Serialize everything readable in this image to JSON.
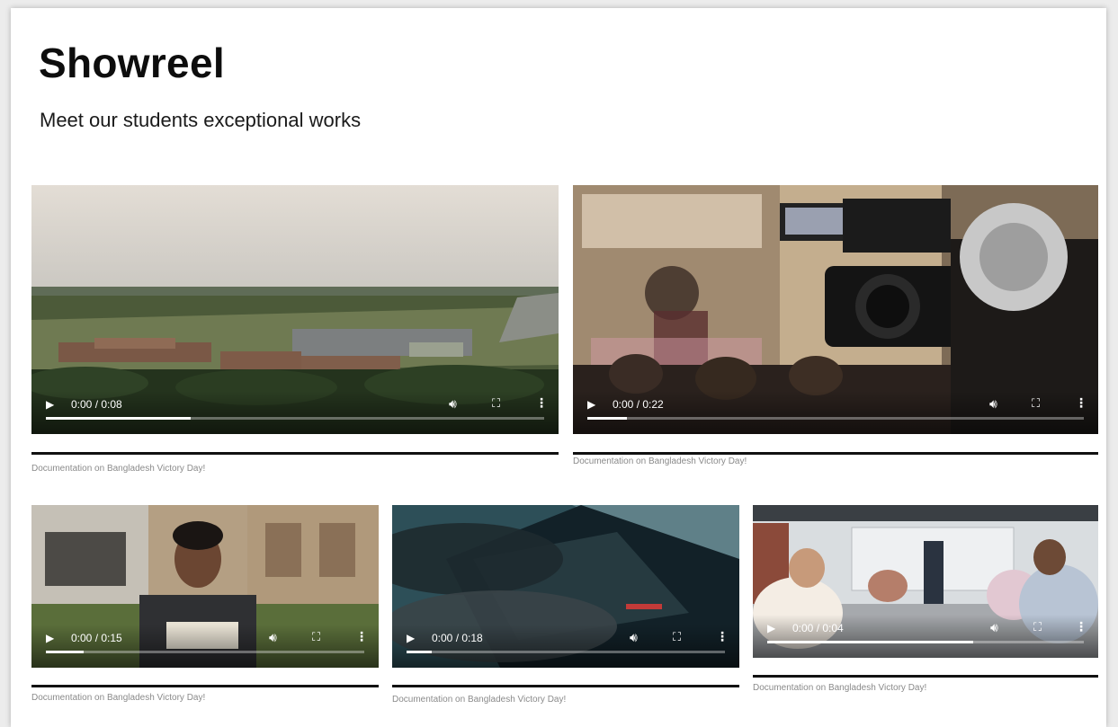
{
  "header": {
    "title": "Showreel",
    "subtitle": "Meet our students exceptional works"
  },
  "colors": {
    "page_bg": "#ffffff",
    "text": "#0d0d0d",
    "caption": "#8a8a8a",
    "rule": "#111111"
  },
  "videos": [
    {
      "time": "0:00 / 0:08",
      "progress": 0.29,
      "caption": "Documentation on Bangladesh Victory Day!",
      "scene": "aerial-campus"
    },
    {
      "time": "0:00 / 0:22",
      "progress": 0.08,
      "caption": "Documentation on Bangladesh Victory Day!",
      "scene": "video-camera"
    },
    {
      "time": "0:00 / 0:15",
      "progress": 0.12,
      "caption": "Documentation on Bangladesh Victory Day!",
      "scene": "student-reading"
    },
    {
      "time": "0:00 / 0:18",
      "progress": 0.08,
      "caption": "Documentation on Bangladesh Victory Day!",
      "scene": "laptop-typing"
    },
    {
      "time": "0:00 / 0:04",
      "progress": 0.65,
      "caption": "Documentation on Bangladesh Victory Day!",
      "scene": "classroom"
    }
  ],
  "icons": {
    "play": "play-icon",
    "volume": "volume-icon",
    "fullscreen": "fullscreen-icon",
    "more": "more-options-icon"
  }
}
